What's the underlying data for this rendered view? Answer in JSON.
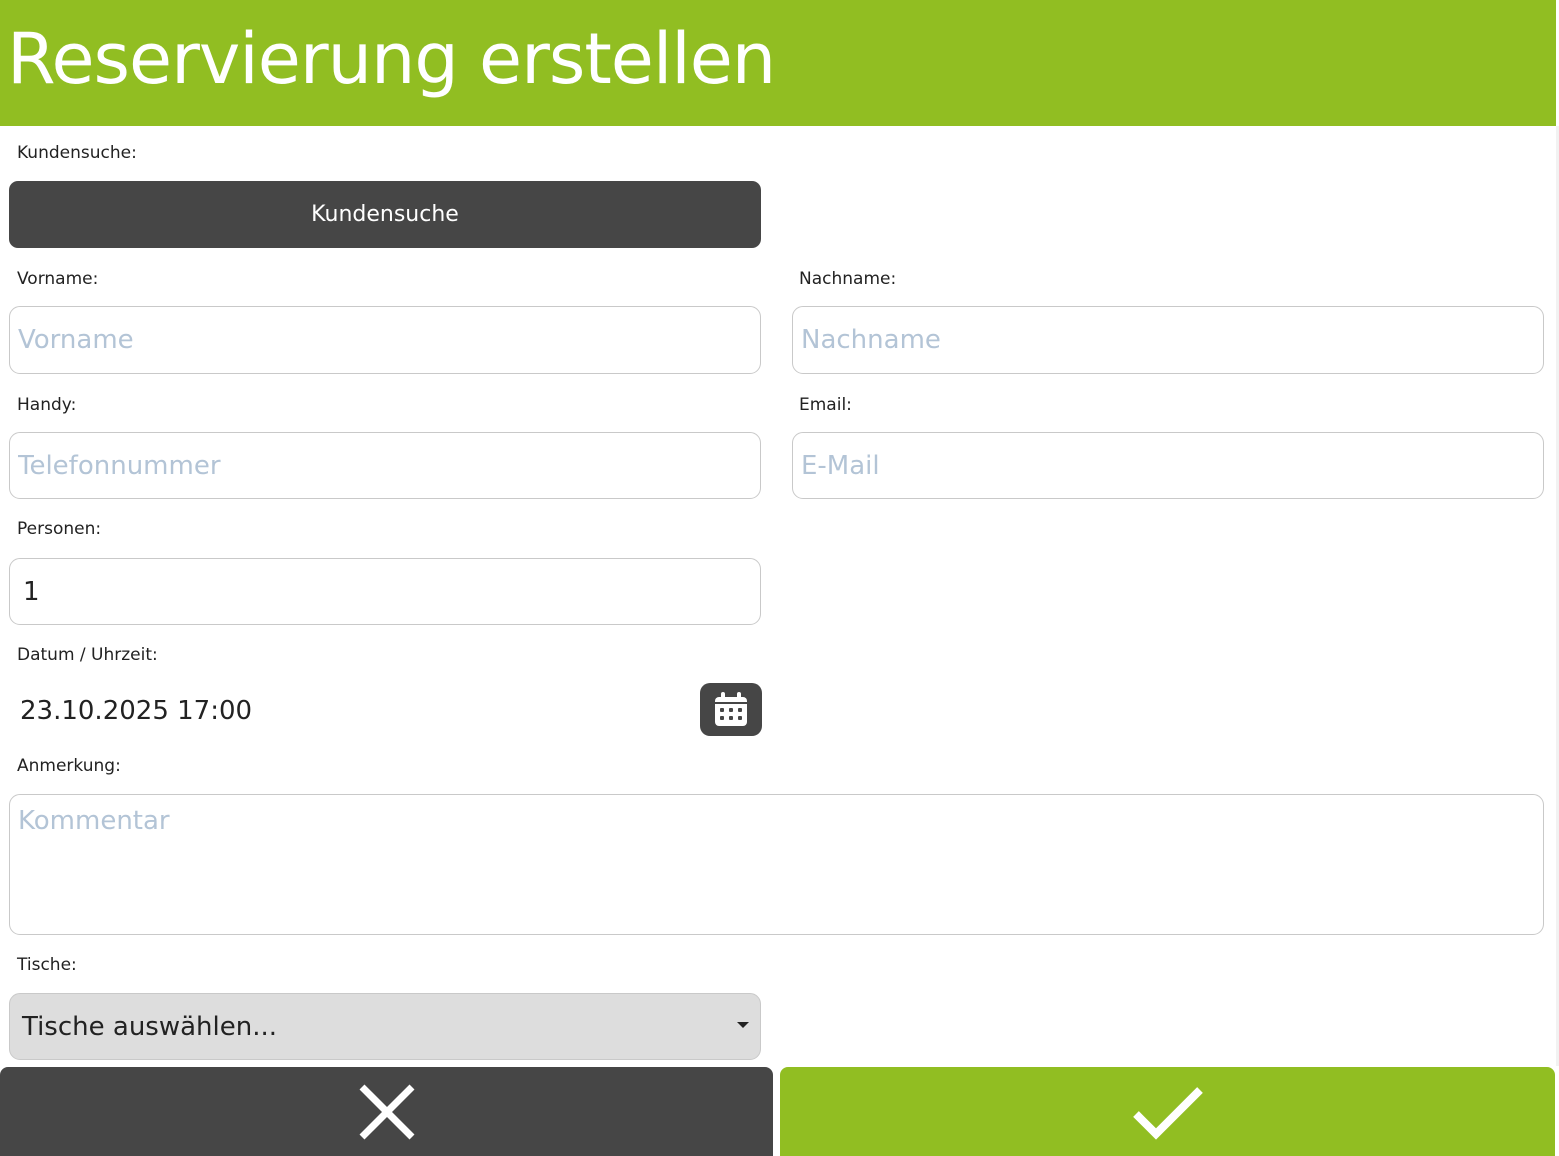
{
  "header": {
    "title": "Reservierung erstellen"
  },
  "colors": {
    "accent": "#91be22",
    "dark": "#464646",
    "placeholder": "#b3c4d6",
    "border": "#c9c9c9"
  },
  "customer_search": {
    "label": "Kundensuche:",
    "button_label": "Kundensuche"
  },
  "first_name": {
    "label": "Vorname:",
    "placeholder": "Vorname",
    "value": ""
  },
  "last_name": {
    "label": "Nachname:",
    "placeholder": "Nachname",
    "value": ""
  },
  "mobile": {
    "label": "Handy:",
    "placeholder": "Telefonnummer",
    "value": ""
  },
  "email": {
    "label": "Email:",
    "placeholder": "E-Mail",
    "value": ""
  },
  "persons": {
    "label": "Personen:",
    "value": "1"
  },
  "datetime": {
    "label": "Datum / Uhrzeit:",
    "value": "23.10.2025 17:00",
    "icon": "calendar-icon"
  },
  "note": {
    "label": "Anmerkung:",
    "placeholder": "Kommentar",
    "value": ""
  },
  "tables": {
    "label": "Tische:",
    "selected": "Tische auswählen...",
    "icon": "caret-down-icon"
  },
  "footer": {
    "cancel_icon": "close-icon",
    "confirm_icon": "checkmark-icon"
  }
}
